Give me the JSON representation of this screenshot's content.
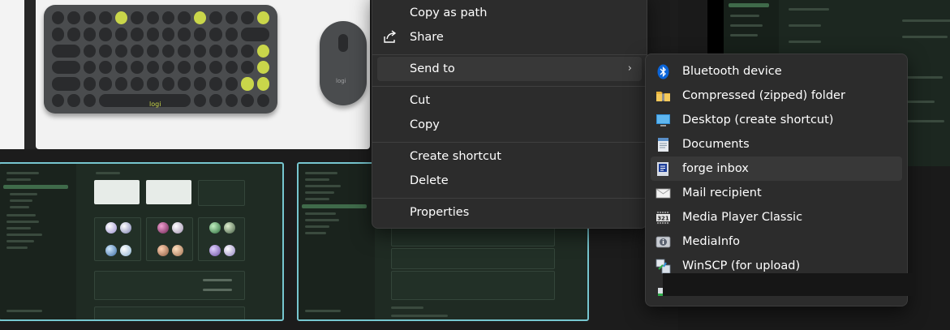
{
  "background": {
    "product_image": {
      "keyboard_logo": "logi",
      "mouse_logo": "logi"
    }
  },
  "context_menu": {
    "items": [
      {
        "id": "copy-as-path",
        "label": "Copy as path",
        "icon": ""
      },
      {
        "id": "share",
        "label": "Share",
        "icon": "share-icon"
      },
      {
        "id": "send-to",
        "label": "Send to",
        "icon": "",
        "has_submenu": true
      },
      {
        "id": "cut",
        "label": "Cut",
        "icon": ""
      },
      {
        "id": "copy",
        "label": "Copy",
        "icon": ""
      },
      {
        "id": "create-shortcut",
        "label": "Create shortcut",
        "icon": ""
      },
      {
        "id": "delete",
        "label": "Delete",
        "icon": ""
      },
      {
        "id": "properties",
        "label": "Properties",
        "icon": ""
      }
    ],
    "chevron": "›"
  },
  "send_to_menu": {
    "items": [
      {
        "id": "bluetooth",
        "label": "Bluetooth device",
        "icon": "bluetooth-icon"
      },
      {
        "id": "compressed",
        "label": "Compressed (zipped) folder",
        "icon": "zip-folder-icon"
      },
      {
        "id": "desktop",
        "label": "Desktop (create shortcut)",
        "icon": "desktop-icon"
      },
      {
        "id": "documents",
        "label": "Documents",
        "icon": "documents-icon"
      },
      {
        "id": "forge-inbox",
        "label": "forge inbox",
        "icon": "forge-inbox-icon"
      },
      {
        "id": "mail",
        "label": "Mail recipient",
        "icon": "mail-icon"
      },
      {
        "id": "mpc",
        "label": "Media Player Classic",
        "icon": "media-player-icon"
      },
      {
        "id": "mediainfo",
        "label": "MediaInfo",
        "icon": "mediainfo-icon"
      },
      {
        "id": "winscp",
        "label": "WinSCP (for upload)",
        "icon": "winscp-icon"
      },
      {
        "id": "redacted",
        "label": "",
        "icon": "drive-icon"
      }
    ]
  },
  "colors": {
    "menu_bg": "#2c2c2c",
    "hover_bg": "#383838",
    "accent_border": "#76c6cf",
    "bluetooth_blue": "#0a64d8"
  }
}
